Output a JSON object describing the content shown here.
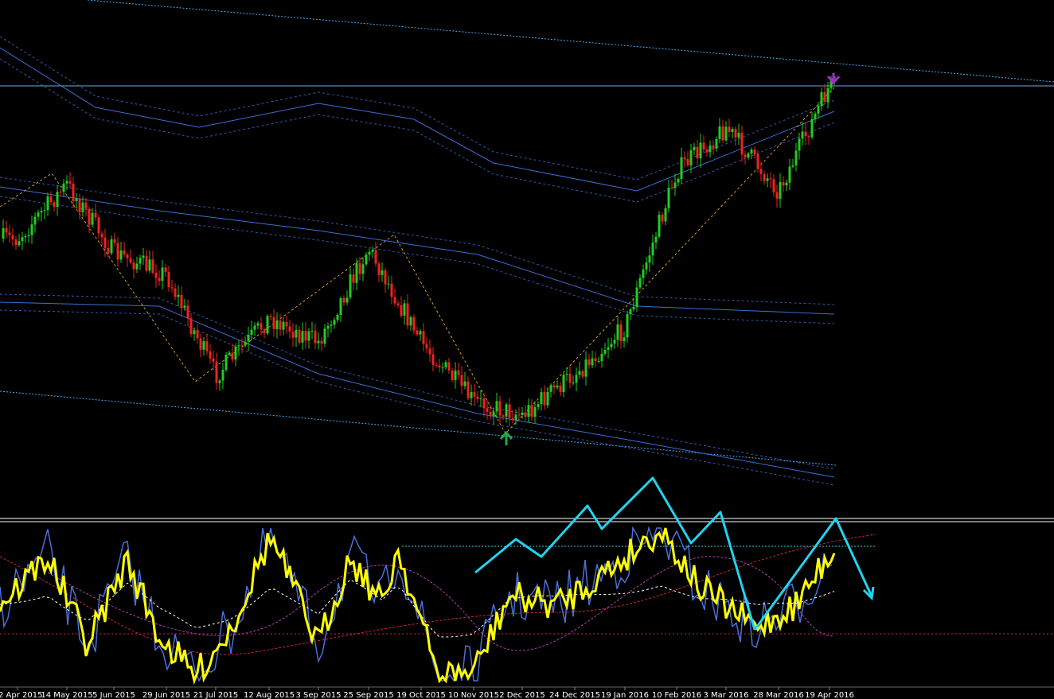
{
  "chart_data": {
    "type": "candlestick",
    "title": "",
    "xlabel": "",
    "ylabel": "",
    "x_tick_labels": [
      "2 Apr 2015",
      "14 May 2015",
      "5 Jun 2015",
      "29 Jun 2015",
      "21 Jul 2015",
      "12 Aug 2015",
      "3 Sep 2015",
      "25 Sep 2015",
      "19 Oct 2015",
      "10 Nov 2015",
      "2 Dec 2015",
      "24 Dec 2015",
      "19 Jan 2016",
      "10 Feb 2016",
      "3 Mar 2016",
      "28 Mar 2016",
      "19 Apr 2016"
    ],
    "price_panel": {
      "grid": false,
      "close_path": [
        [
          "2 Apr 2015",
          300
        ],
        [
          "14 May 2015",
          232
        ],
        [
          "5 Jun 2015",
          318
        ],
        [
          "29 Jun 2015",
          345
        ],
        [
          "21 Jul 2015",
          472
        ],
        [
          "12 Aug 2015",
          400
        ],
        [
          "3 Sep 2015",
          430
        ],
        [
          "25 Sep 2015",
          312
        ],
        [
          "19 Oct 2015",
          430
        ],
        [
          "10 Nov 2015",
          505
        ],
        [
          "2 Dec 2015",
          522
        ],
        [
          "24 Dec 2015",
          470
        ],
        [
          "19 Jan 2016",
          412
        ],
        [
          "10 Feb 2016",
          215
        ],
        [
          "3 Mar 2016",
          160
        ],
        [
          "28 Mar 2016",
          240
        ],
        [
          "19 Apr 2016",
          108
        ]
      ],
      "up_color": "#22cc22",
      "down_color": "#ee2222",
      "horizontal_level_color": "#6fa8dc",
      "channel_color": "#3a6fd8",
      "trendline_color": "#3ab0ff",
      "zigzag_color": "#d4a017",
      "sell_arrow_color": "#9b30c8",
      "buy_arrow_color": "#1fa84a"
    },
    "oscillator_panel": {
      "series": [
        {
          "color": "#ffff00"
        },
        {
          "color": "#4a6fd8"
        },
        {
          "color": "#ffffff"
        },
        {
          "color": "#cc2244"
        }
      ],
      "annotation_color": "#22d3ee"
    }
  }
}
